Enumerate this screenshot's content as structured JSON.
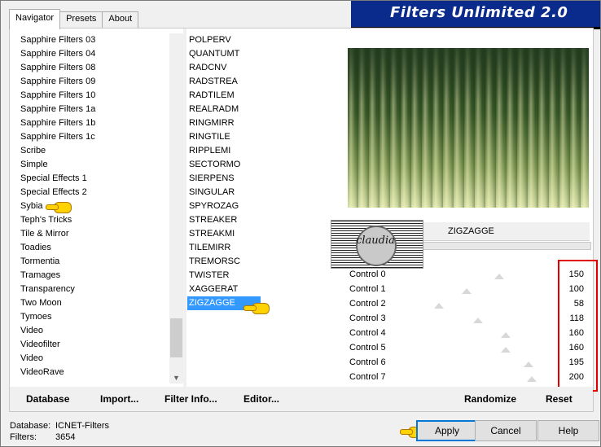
{
  "tabs": [
    "Navigator",
    "Presets",
    "About"
  ],
  "banner_title": "Filters Unlimited 2.0",
  "categories": [
    "Sapphire Filters 03",
    "Sapphire Filters 04",
    "Sapphire Filters 08",
    "Sapphire Filters 09",
    "Sapphire Filters 10",
    "Sapphire Filters 1a",
    "Sapphire Filters 1b",
    "Sapphire Filters 1c",
    "Scribe",
    "Simple",
    "Special Effects 1",
    "Special Effects 2",
    "Sybia",
    "Teph's Tricks",
    "Tile & Mirror",
    "Toadies",
    "Tormentia",
    "Tramages",
    "Transparency",
    "Two Moon",
    "Tymoes",
    "Video",
    "Videofilter",
    "Video",
    "VideoRave"
  ],
  "filters": [
    "POLPERV",
    "QUANTUMT",
    "RADCNV",
    "RADSTREA",
    "RADTILEM",
    "REALRADM",
    "RINGMIRR",
    "RINGTILE",
    "RIPPLEMI",
    "SECTORMO",
    "SIERPENS",
    "SINGULAR",
    "SPYROZAG",
    "STREAKER",
    "STREAKMI",
    "TILEMIRR",
    "TREMORSC",
    "TWISTER",
    "XAGGERAT",
    "ZIGZAGGE"
  ],
  "selected_filter": "ZIGZAGGE",
  "selected_category": "Sybia",
  "filter_name": "ZIGZAGGE",
  "watermark_text": "claudia",
  "controls": [
    {
      "label": "Control 0",
      "value": "150",
      "level": 150
    },
    {
      "label": "Control 1",
      "value": "100",
      "level": 100
    },
    {
      "label": "Control 2",
      "value": "58",
      "level": 58
    },
    {
      "label": "Control 3",
      "value": "118",
      "level": 118
    },
    {
      "label": "Control 4",
      "value": "160",
      "level": 160
    },
    {
      "label": "Control 5",
      "value": "160",
      "level": 160
    },
    {
      "label": "Control 6",
      "value": "195",
      "level": 195
    },
    {
      "label": "Control 7",
      "value": "200",
      "level": 200
    }
  ],
  "panel_buttons": {
    "database": "Database",
    "import": "Import...",
    "filter_info": "Filter Info...",
    "editor": "Editor...",
    "randomize": "Randomize",
    "reset": "Reset"
  },
  "status": {
    "db_label": "Database:",
    "db_value": "ICNET-Filters",
    "filters_label": "Filters:",
    "filters_value": "3654"
  },
  "dialog_buttons": {
    "apply": "Apply",
    "cancel": "Cancel",
    "help": "Help"
  },
  "colors": {
    "banner": "#0a2b8c",
    "selection": "#3399ff",
    "highlight_box": "#e00000"
  }
}
